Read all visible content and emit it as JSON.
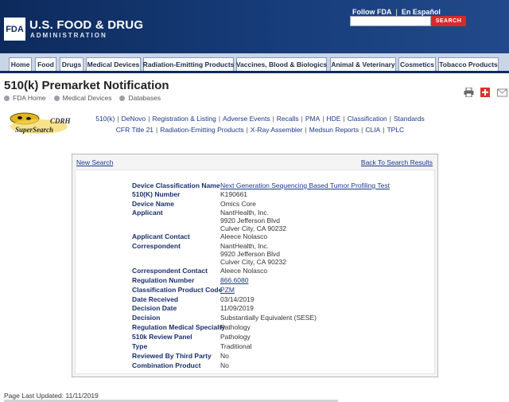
{
  "header": {
    "logo_text": "FDA",
    "agency_name": "U.S. FOOD & DRUG",
    "agency_sub": "ADMINISTRATION",
    "follow_fda": "Follow FDA",
    "en_espanol": "En Español",
    "search_button": "SEARCH",
    "search_placeholder": ""
  },
  "nav": {
    "tabs": [
      "Home",
      "Food",
      "Drugs",
      "Medical Devices",
      "Radiation-Emitting Products",
      "Vaccines, Blood & Biologics",
      "Animal & Veterinary",
      "Cosmetics",
      "Tobacco Products"
    ]
  },
  "page": {
    "title": "510(k) Premarket Notification",
    "breadcrumb": [
      "FDA Home",
      "Medical Devices",
      "Databases"
    ]
  },
  "cdrh": {
    "logo_line1": "CDRH",
    "logo_line2": "SuperSearch"
  },
  "links": {
    "line1": [
      "510(k)",
      "DeNovo",
      "Registration & Listing",
      "Adverse Events",
      "Recalls",
      "PMA",
      "HDE",
      "Classification",
      "Standards"
    ],
    "line2": [
      "CFR Title 21",
      "Radiation-Emitting Products",
      "X-Ray Assembler",
      "Medsun Reports",
      "CLIA",
      "TPLC"
    ]
  },
  "results": {
    "new_search": "New Search",
    "back_to_results": "Back To Search Results",
    "fields": {
      "device_classification_name": {
        "label": "Device Classification Name",
        "value": "Next Generation Sequencing Based Tumor Profiling Test"
      },
      "k_number": {
        "label": "510(K) Number",
        "value": "K190661"
      },
      "device_name": {
        "label": "Device Name",
        "value": "Omics Core"
      },
      "applicant": {
        "label": "Applicant",
        "lines": [
          "NantHealth, Inc.",
          "9920 Jefferson Blvd",
          "Culver City,  CA  90232"
        ]
      },
      "applicant_contact": {
        "label": "Applicant Contact",
        "value": "Aleece Nolasco"
      },
      "correspondent": {
        "label": "Correspondent",
        "lines": [
          "NantHealth, Inc.",
          "9920 Jefferson Blvd",
          "Culver City,  CA  90232"
        ]
      },
      "correspondent_contact": {
        "label": "Correspondent Contact",
        "value": "Aleece Nolasco"
      },
      "regulation_number": {
        "label": "Regulation Number",
        "value": "866.6080"
      },
      "classification_product_code": {
        "label": "Classification Product Code",
        "value": "PZM"
      },
      "date_received": {
        "label": "Date Received",
        "value": "03/14/2019"
      },
      "decision_date": {
        "label": "Decision Date",
        "value": "11/09/2019"
      },
      "decision": {
        "label": "Decision",
        "value": "Substantially Equivalent (SESE)"
      },
      "regulation_medical_specialty": {
        "label": "Regulation Medical Specialty",
        "value": "Pathology"
      },
      "review_panel": {
        "label": "510k Review Panel",
        "value": "Pathology"
      },
      "type": {
        "label": "Type",
        "value": "Traditional"
      },
      "third_party": {
        "label": "Reviewed By Third Party",
        "value": "No"
      },
      "combination_product": {
        "label": "Combination Product",
        "value": "No"
      }
    }
  },
  "footer": {
    "last_updated": "Page Last Updated: 11/11/2019"
  },
  "colors": {
    "header_bg": "#173d7a",
    "nav_bg": "#c9d6e8",
    "search_button": "#d62b2b",
    "link": "#1a3a8a",
    "label": "#1a2f6e"
  }
}
